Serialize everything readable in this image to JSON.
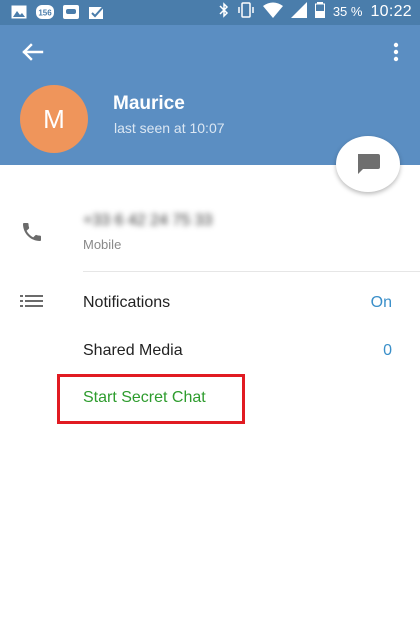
{
  "status_bar": {
    "notification_icons": [
      "image-icon",
      "badge-156-icon",
      "shield-icon",
      "task-check-icon"
    ],
    "badge_text": "156",
    "system_icons": [
      "bluetooth-icon",
      "vibrate-icon",
      "wifi-icon",
      "signal-icon",
      "battery-icon"
    ],
    "battery_percent": "35 %",
    "time": "10:22"
  },
  "header": {
    "avatar_letter": "M",
    "avatar_color": "#ef955b",
    "name": "Maurice",
    "status": "last seen at 10:07",
    "background": "#5b8ec2"
  },
  "phone": {
    "number": "+33 6 42 24 75 33",
    "label": "Mobile"
  },
  "items": {
    "notifications": {
      "label": "Notifications",
      "value": "On"
    },
    "shared_media": {
      "label": "Shared Media",
      "value": "0"
    },
    "secret_chat": {
      "label": "Start Secret Chat"
    }
  },
  "colors": {
    "accent_value": "#3a8fc9",
    "secret_chat": "#2e9c2e",
    "highlight": "#e11b22"
  }
}
